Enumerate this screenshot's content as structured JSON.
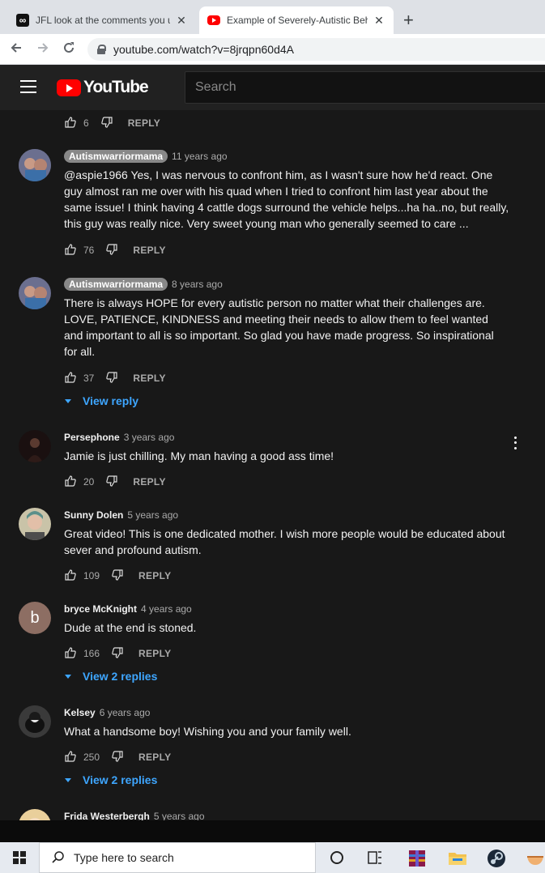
{
  "browser": {
    "tabs": [
      {
        "title": "JFL look at the comments you ut",
        "active": false
      },
      {
        "title": "Example of Severely-Autistic Beh",
        "active": true
      }
    ],
    "new_tab": "+",
    "close_glyph": "✕",
    "url": "youtube.com/watch?v=8jrqpn60d4A"
  },
  "youtube": {
    "logo_text": "YouTube",
    "search_placeholder": "Search"
  },
  "reply_label": "REPLY",
  "top_partial": {
    "likes": "6"
  },
  "comments": [
    {
      "author": "Autismwarriormama",
      "owner_chip": true,
      "time": "11 years ago",
      "text": "@aspie1966 Yes, I was nervous to confront him, as I wasn't sure how he'd react. One guy almost ran me over with his quad when I tried to confront him last year about the same issue! I think having 4 cattle dogs surround the vehicle helps...ha ha..no, but really, this guy was really nice. Very sweet young man who generally seemed to care ...",
      "likes": "76"
    },
    {
      "author": "Autismwarriormama",
      "owner_chip": true,
      "time": "8 years ago",
      "text": "There is always HOPE for every autistic person no matter what their challenges are. LOVE, PATIENCE, KINDNESS and meeting their needs to allow them to feel wanted and important to all is so important. So glad you have made progress. So inspirational for all.",
      "likes": "37",
      "view_replies": "View reply"
    },
    {
      "author": "Persephone",
      "owner_chip": false,
      "time": "3 years ago",
      "text": "Jamie is just chilling. My man having a good ass time!",
      "likes": "20"
    },
    {
      "author": "Sunny Dolen",
      "owner_chip": false,
      "time": "5 years ago",
      "text": "Great video! This is one dedicated mother. I wish more people would be educated about sever and profound autism.",
      "likes": "109"
    },
    {
      "author": "bryce McKnight",
      "owner_chip": false,
      "time": "4 years ago",
      "text": "Dude at the end is stoned.",
      "likes": "166",
      "avatar_letter": "b",
      "view_replies": "View 2 replies"
    },
    {
      "author": "Kelsey",
      "owner_chip": false,
      "time": "6 years ago",
      "text": "What a handsome boy! Wishing you and your family well.",
      "likes": "250",
      "view_replies": "View 2 replies"
    },
    {
      "author": "Frida Westerbergh",
      "owner_chip": false,
      "time": "5 years ago"
    }
  ],
  "taskbar": {
    "search_placeholder": "Type here to search",
    "icons": [
      "windows-start-icon",
      "cortana-icon",
      "task-view-icon",
      "winrar-icon",
      "file-explorer-icon",
      "steam-icon",
      "bowl-app-icon"
    ]
  },
  "colors": {
    "page_bg": "#181818",
    "header_bg": "#212121",
    "link_blue": "#3ea6ff",
    "yt_red": "#ff0000",
    "chip_gray": "#888888"
  }
}
